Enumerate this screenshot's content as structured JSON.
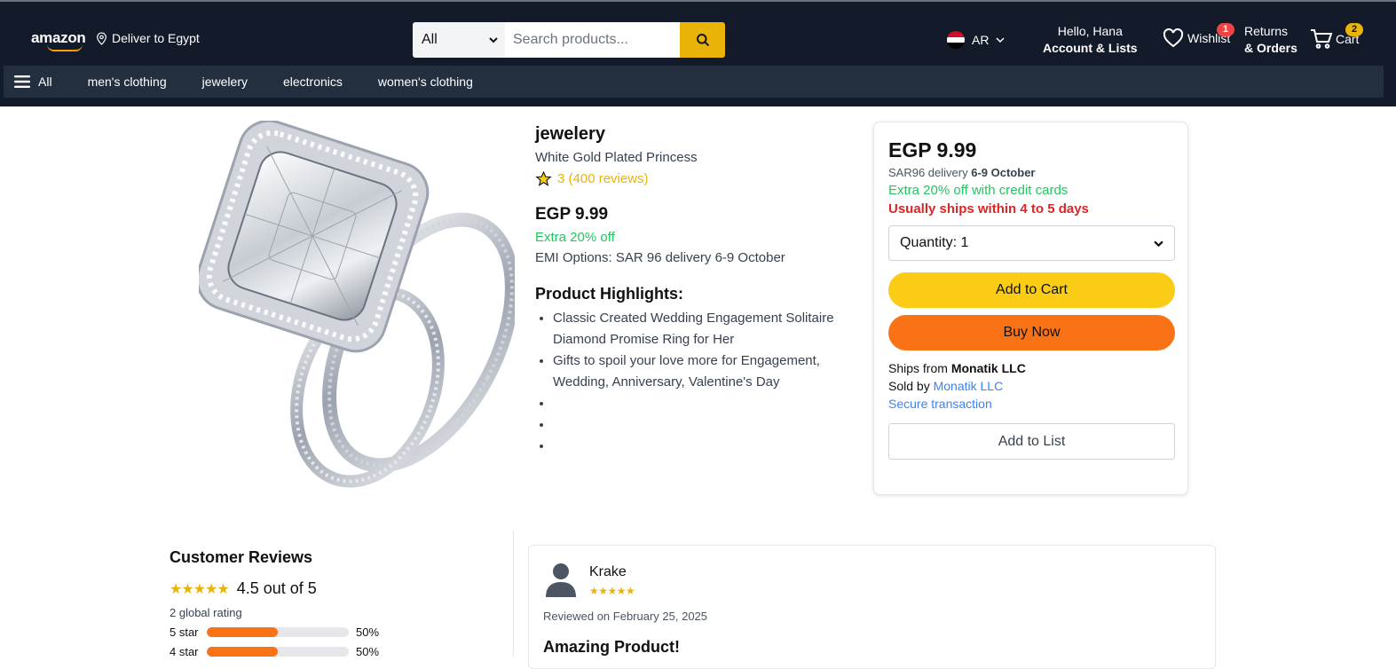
{
  "header": {
    "logo": "amazon",
    "deliver": "Deliver to Egypt",
    "search": {
      "category": "All",
      "placeholder": "Search products..."
    },
    "language": "AR",
    "account": {
      "greeting": "Hello, Hana",
      "label": "Account & Lists"
    },
    "wishlist": {
      "label": "Wishlist",
      "count": "1"
    },
    "returns": {
      "line1": "Returns",
      "line2": "& Orders"
    },
    "cart": {
      "label": "Cart",
      "count": "2"
    }
  },
  "subnav": {
    "all": "All",
    "categories": [
      "men's clothing",
      "jewelery",
      "electronics",
      "women's clothing"
    ]
  },
  "product": {
    "category": "jewelery",
    "name": "White Gold Plated Princess",
    "rating": "3 (400 reviews)",
    "price": "EGP 9.99",
    "extra": "Extra 20% off",
    "emi": "EMI Options: SAR 96 delivery 6-9 October",
    "highlights_title": "Product Highlights:",
    "highlights": [
      "Classic Created Wedding Engagement Solitaire Diamond Promise Ring for Her",
      "Gifts to spoil your love more for Engagement, Wedding, Anniversary, Valentine's Day",
      "",
      "",
      ""
    ]
  },
  "buybox": {
    "price": "EGP 9.99",
    "ship_prefix": "SAR96 delivery",
    "ship_date": "6-9 October",
    "credit": "Extra 20% off with credit cards",
    "usually": "Usually ships within 4 to 5 days",
    "quantity": "Quantity: 1",
    "add_to_cart": "Add to Cart",
    "buy_now": "Buy Now",
    "ships_from_label": "Ships from",
    "ships_from": "Monatik LLC",
    "sold_by_label": "Sold by",
    "sold_by": "Monatik LLC",
    "secure": "Secure transaction",
    "add_to_list": "Add to List"
  },
  "reviews": {
    "title": "Customer Reviews",
    "stars": "★★★★★",
    "score": "4.5 out of 5",
    "global": "2 global rating",
    "breakdown": [
      {
        "label": "5 star",
        "fraction": 0.5,
        "pct": "50%"
      },
      {
        "label": "4 star",
        "fraction": 0.5,
        "pct": "50%"
      }
    ]
  },
  "review": {
    "name": "Krake",
    "stars": "★★★★★",
    "date": "Reviewed on February 25, 2025",
    "title": "Amazing Product!"
  },
  "colors": {
    "header_bg": "#131a2a",
    "subnav_bg": "#232f3e",
    "accent_yellow": "#eab308",
    "buy_orange": "#f97316",
    "green": "#22c55e",
    "red": "#dc2626",
    "link_blue": "#3b82f6"
  }
}
